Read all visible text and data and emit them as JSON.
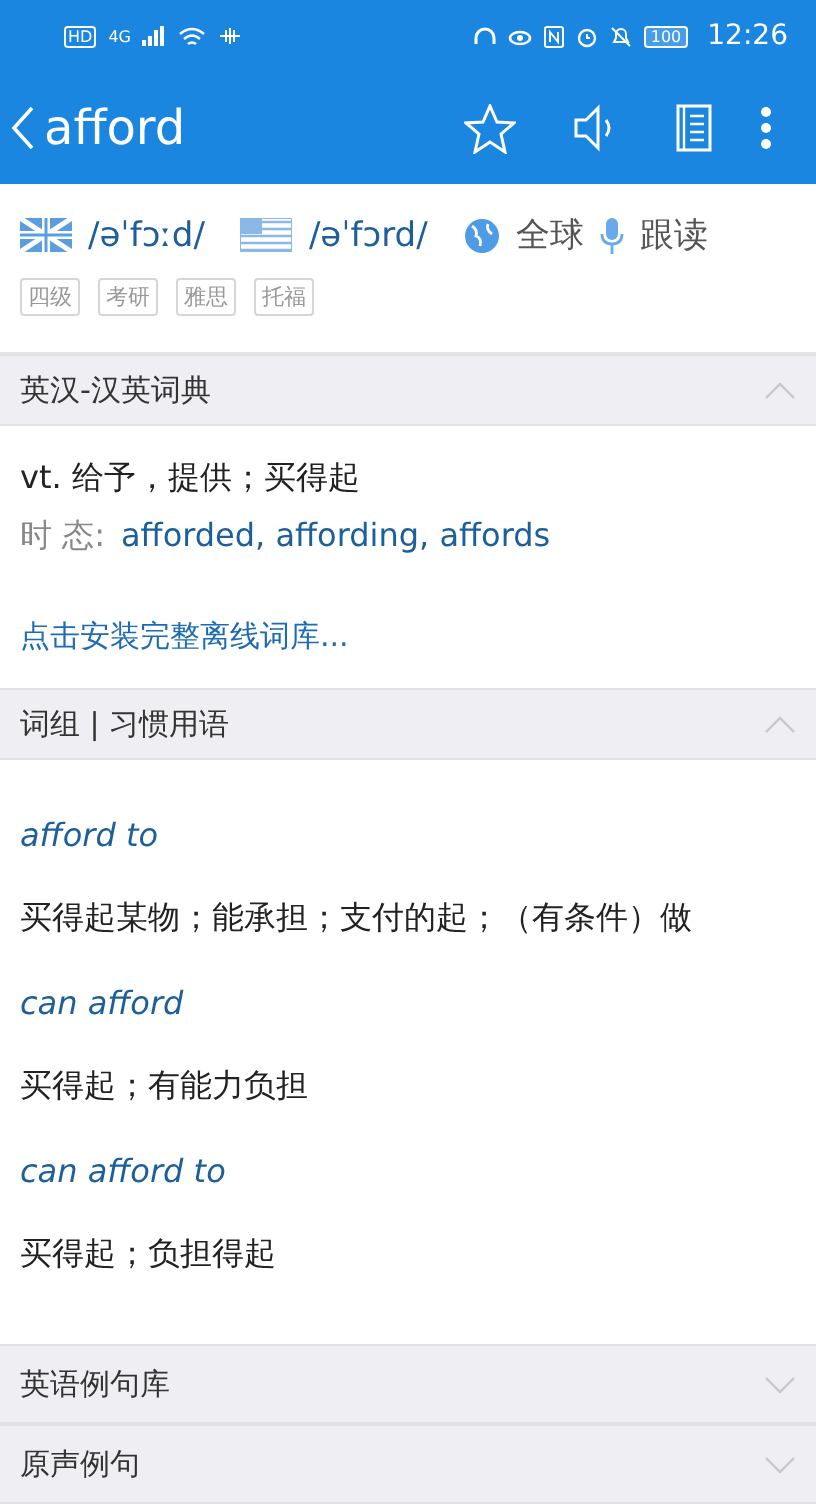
{
  "status_bar": {
    "hd": "HD",
    "network": "4G",
    "time": "12:26",
    "battery": "100"
  },
  "app_bar": {
    "title": "afford"
  },
  "pronunciation": [
    {
      "kind": "uk",
      "phonetic": "/əˈfɔːd/"
    },
    {
      "kind": "us",
      "phonetic": "/əˈfɔrd/"
    }
  ],
  "global_label": "全球",
  "follow_label": "跟读",
  "tags": [
    "四级",
    "考研",
    "雅思",
    "托福"
  ],
  "sections": [
    {
      "title": "英汉-汉英词典",
      "expanded": true,
      "kind": "dict",
      "definition": "vt. 给予，提供；买得起",
      "tense_label": "时 态:",
      "tense_forms": "afforded, affording, affords",
      "install_link": "点击安装完整离线词库..."
    },
    {
      "title": "词组 | 习惯用语",
      "expanded": true,
      "kind": "phrases",
      "phrases": [
        {
          "phrase": "afford to",
          "meaning": "买得起某物；能承担；支付的起；（有条件）做"
        },
        {
          "phrase": "can afford",
          "meaning": "买得起；有能力负担"
        },
        {
          "phrase": "can afford to",
          "meaning": "买得起；负担得起"
        }
      ]
    },
    {
      "title": "英语例句库",
      "expanded": false
    },
    {
      "title": "原声例句",
      "expanded": false
    }
  ]
}
